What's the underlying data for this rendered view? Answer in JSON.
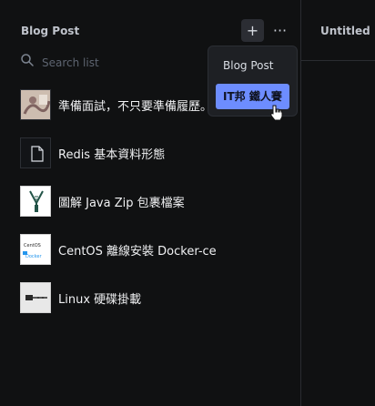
{
  "header": {
    "title": "Blog Post",
    "plus_label": "+",
    "more_label": "···",
    "right_tab_title": "Untitled"
  },
  "search": {
    "placeholder": "Search list"
  },
  "items": [
    {
      "label": "準備面試，不只要準備履歷。"
    },
    {
      "label": "Redis 基本資料形態"
    },
    {
      "label": "圖解 Java Zip 包裹檔案"
    },
    {
      "label": "CentOS 離線安裝 Docker-ce"
    },
    {
      "label": "Linux 硬碟掛載"
    }
  ],
  "menu": {
    "items": [
      {
        "label": "Blog Post"
      },
      {
        "label": "IT邦 鐵人賽"
      }
    ]
  },
  "thumbs": {
    "centos_top": "CentOS",
    "centos_bottom": "Docker"
  },
  "colors": {
    "accent": "#6d8dff",
    "background": "#101112"
  },
  "icons": {
    "search": "search-icon",
    "plus": "plus-icon",
    "more": "more-icon",
    "document": "document-icon",
    "cursor": "pointer-cursor-icon"
  }
}
